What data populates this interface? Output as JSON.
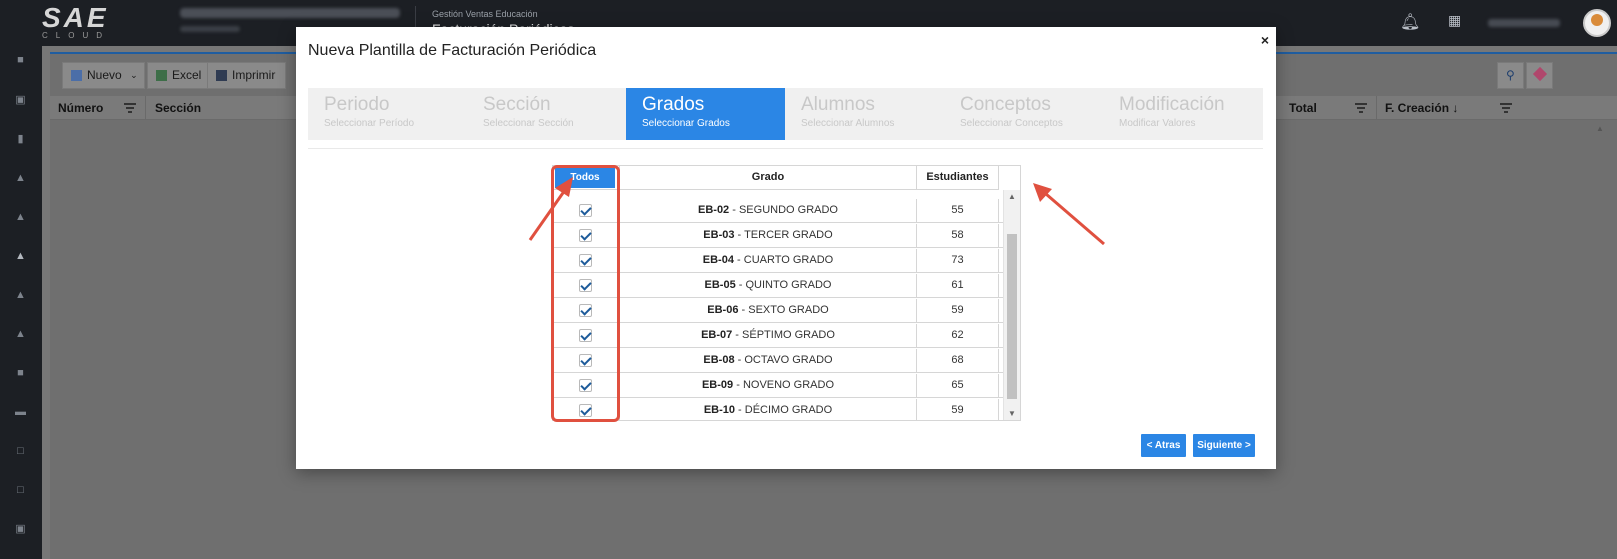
{
  "app": {
    "logo": "SAE",
    "logo_sub": "CLOUD",
    "module_subtitle": "Gestión Ventas Educación",
    "module_title": "Facturación Periódicas"
  },
  "toolbar": {
    "new_label": "Nuevo",
    "excel_label": "Excel",
    "print_label": "Imprimir"
  },
  "grid": {
    "headers": [
      "Número",
      "Sección",
      "Total",
      "F. Creación ↓"
    ]
  },
  "modal": {
    "title": "Nueva Plantilla de Facturación Periódica",
    "close": "×",
    "steps": [
      {
        "title": "Periodo",
        "subtitle": "Seleccionar Período",
        "active": false
      },
      {
        "title": "Sección",
        "subtitle": "Seleccionar Sección",
        "active": false
      },
      {
        "title": "Grados",
        "subtitle": "Seleccionar Grados",
        "active": true
      },
      {
        "title": "Alumnos",
        "subtitle": "Seleccionar Alumnos",
        "active": false
      },
      {
        "title": "Conceptos",
        "subtitle": "Seleccionar Conceptos",
        "active": false
      },
      {
        "title": "Modificación",
        "subtitle": "Modificar Valores",
        "active": false
      }
    ],
    "table": {
      "select_all_label": "Todos",
      "col_grado": "Grado",
      "col_estudiantes": "Estudiantes",
      "rows": [
        {
          "code": "EB-02",
          "name": "SEGUNDO GRADO",
          "students": "55",
          "checked": true
        },
        {
          "code": "EB-03",
          "name": "TERCER GRADO",
          "students": "58",
          "checked": true
        },
        {
          "code": "EB-04",
          "name": "CUARTO GRADO",
          "students": "73",
          "checked": true
        },
        {
          "code": "EB-05",
          "name": "QUINTO GRADO",
          "students": "61",
          "checked": true
        },
        {
          "code": "EB-06",
          "name": "SEXTO GRADO",
          "students": "59",
          "checked": true
        },
        {
          "code": "EB-07",
          "name": "SÉPTIMO GRADO",
          "students": "62",
          "checked": true
        },
        {
          "code": "EB-08",
          "name": "OCTAVO GRADO",
          "students": "68",
          "checked": true
        },
        {
          "code": "EB-09",
          "name": "NOVENO GRADO",
          "students": "65",
          "checked": true
        },
        {
          "code": "EB-10",
          "name": "DÉCIMO GRADO",
          "students": "59",
          "checked": true
        }
      ]
    },
    "back_label": "< Atras",
    "next_label": "Siguiente >"
  },
  "colors": {
    "accent": "#2b86e5",
    "annotation": "#e0503f"
  }
}
